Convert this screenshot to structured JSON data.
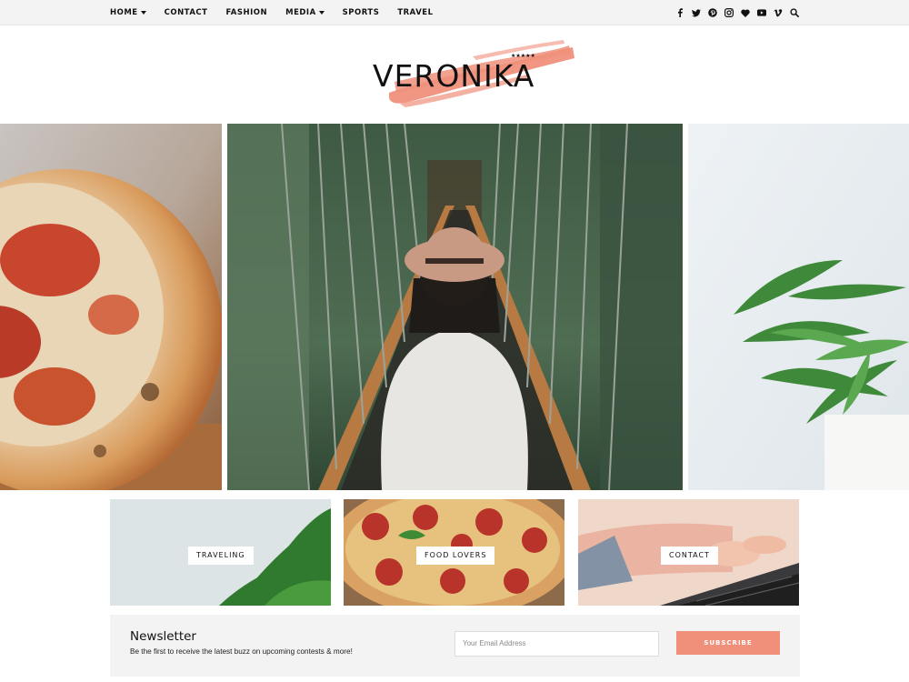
{
  "nav": {
    "items": [
      {
        "label": "HOME",
        "has_caret": true
      },
      {
        "label": "CONTACT",
        "has_caret": false
      },
      {
        "label": "FASHION",
        "has_caret": false
      },
      {
        "label": "MEDIA",
        "has_caret": true
      },
      {
        "label": "SPORTS",
        "has_caret": false
      },
      {
        "label": "TRAVEL",
        "has_caret": false
      }
    ],
    "social_icons": [
      "facebook-icon",
      "twitter-icon",
      "pinterest-icon",
      "instagram-icon",
      "heart-icon",
      "youtube-icon",
      "vimeo-icon",
      "search-icon"
    ]
  },
  "logo": {
    "text": "VERONIKA",
    "stars": "★★★★★",
    "brush_color": "#f0907b"
  },
  "categories": [
    {
      "label": "TRAVELING"
    },
    {
      "label": "FOOD LOVERS"
    },
    {
      "label": "CONTACT"
    }
  ],
  "newsletter": {
    "title": "Newsletter",
    "subtitle": "Be the first to receive the latest buzz on upcoming contests & more!",
    "input_placeholder": "Your Email Address",
    "button_label": "SUBSCRIBE"
  },
  "colors": {
    "accent": "#f0907b",
    "topbar_bg": "#f3f3f3",
    "newsletter_bg": "#f3f3f3"
  }
}
